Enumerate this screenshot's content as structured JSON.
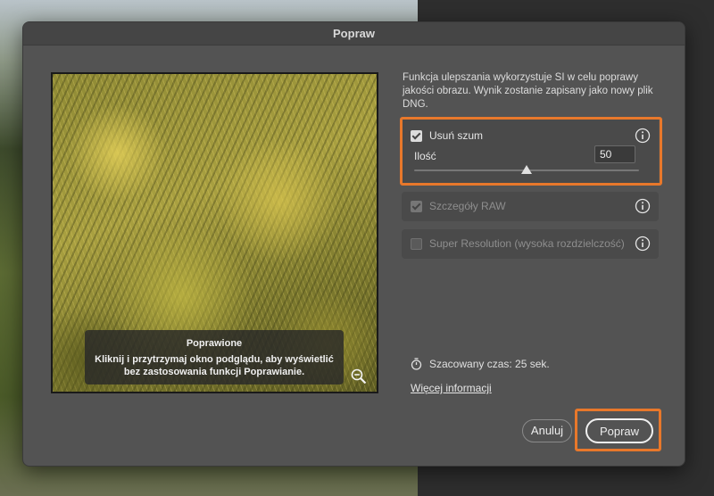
{
  "dialog": {
    "title": "Popraw",
    "description": "Funkcja ulepszania wykorzystuje SI w celu poprawy jakości obrazu. Wynik zostanie zapisany jako nowy plik DNG."
  },
  "preview": {
    "overlay_title": "Poprawione",
    "overlay_text_line1": "Kliknij i przytrzymaj okno podglądu, aby wyświetlić",
    "overlay_text_line2": "bez zastosowania funkcji Poprawianie.",
    "zoom_icon": "zoom-out-icon"
  },
  "options": {
    "denoise": {
      "label": "Usuń szum",
      "checked": true,
      "amount_label": "Ilość",
      "amount_value": "50",
      "slider_value": 50,
      "slider_max": 100
    },
    "raw_details": {
      "label": "Szczegóły RAW",
      "checked": true,
      "disabled": true
    },
    "super_resolution": {
      "label": "Super Resolution (wysoka rozdzielczość)",
      "checked": false
    }
  },
  "estimate": {
    "text": "Szacowany czas: 25 sek.",
    "icon": "stopwatch-icon"
  },
  "more_info_link": "Więcej informacji",
  "buttons": {
    "cancel": "Anuluj",
    "enhance": "Popraw"
  },
  "colors": {
    "highlight": "#e8782b",
    "dialog_bg": "#535353"
  }
}
